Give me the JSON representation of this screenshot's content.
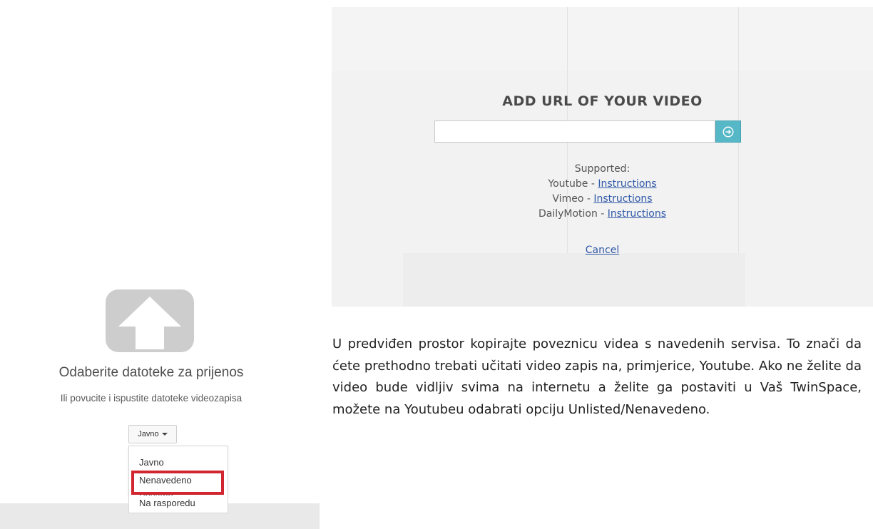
{
  "url_panel": {
    "title": "ADD URL OF YOUR VIDEO",
    "input_value": "",
    "submit_icon": "arrow-right-circle-icon",
    "supported_label": "Supported:",
    "services": [
      {
        "name": "Youtube - ",
        "link": "Instructions"
      },
      {
        "name": "Vimeo - ",
        "link": "Instructions"
      },
      {
        "name": "DailyMotion - ",
        "link": "Instructions"
      }
    ],
    "cancel_label": "Cancel"
  },
  "upload": {
    "icon": "upload-icon",
    "title": "Odaberite datoteke za prijenos",
    "subtitle": "Ili povucite i ispustite datoteke videozapisa",
    "privacy_button": "Javno",
    "options": [
      "Javno",
      "Nenavedeno",
      "Privatno",
      "Na rasporedu"
    ],
    "highlight_color": "#d12630"
  },
  "paragraph": "U predviđen prostor kopirajte poveznicu videa s navedenih servisa. To znači da ćete prethodno trebati učitati video zapis na, primjerice, Youtube. Ako ne želite da video bude vidljiv svima na internetu a želite ga postaviti u Vaš TwinSpace, možete na Youtubeu odabrati opciju Unlisted/Nenavedeno.",
  "colors": {
    "accent": "#56b7c6",
    "link": "#2f58a8"
  }
}
